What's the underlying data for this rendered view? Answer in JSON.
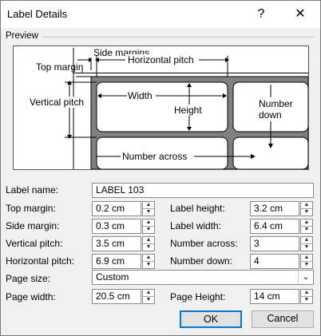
{
  "window": {
    "title": "Label Details",
    "help_glyph": "?",
    "close_glyph": "✕"
  },
  "preview": {
    "section_label": "Preview",
    "labels": {
      "side_margins": "Side margins",
      "top_margin": "Top margin",
      "horizontal_pitch": "Horizontal pitch",
      "vertical_pitch": "Vertical pitch",
      "width": "Width",
      "height": "Height",
      "number_down_1": "Number",
      "number_down_2": "down",
      "number_across": "Number across"
    }
  },
  "fields": {
    "label_name": {
      "label": "Label name:",
      "value": "LABEL 103"
    },
    "top_margin": {
      "label": "Top margin:",
      "value": "0.2 cm"
    },
    "side_margin": {
      "label": "Side margin:",
      "value": "0.3 cm"
    },
    "vertical_pitch": {
      "label": "Vertical pitch:",
      "value": "3.5 cm"
    },
    "horizontal_pitch": {
      "label": "Horizontal pitch:",
      "value": "6.9 cm"
    },
    "label_height": {
      "label": "Label height:",
      "value": "3.2 cm"
    },
    "label_width": {
      "label": "Label width:",
      "value": "6.4 cm"
    },
    "number_across": {
      "label": "Number across:",
      "value": "3"
    },
    "number_down": {
      "label": "Number down:",
      "value": "4"
    },
    "page_size": {
      "label": "Page size:",
      "value": "Custom"
    },
    "page_width": {
      "label": "Page width:",
      "value": "20.5 cm"
    },
    "page_height": {
      "label": "Page Height:",
      "value": "14 cm"
    }
  },
  "buttons": {
    "ok": "OK",
    "cancel": "Cancel"
  },
  "icons": {
    "spin_up": "up-arrow-icon",
    "spin_down": "down-arrow-icon",
    "dropdown": "chevron-down-icon"
  }
}
